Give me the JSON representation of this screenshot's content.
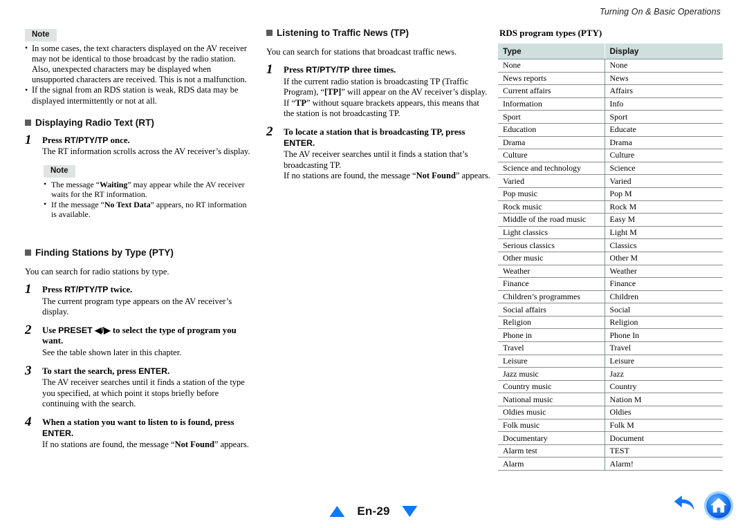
{
  "header": {
    "running_title": "Turning On & Basic Operations"
  },
  "column1": {
    "note_top": {
      "badge": "Note",
      "items": [
        "In some cases, the text characters displayed on the AV receiver may not be identical to those broadcast by the radio station. Also, unexpected characters may be displayed when unsupported characters are received. This is not a malfunction.",
        "If the signal from an RDS station is weak, RDS data may be displayed intermittently or not at all."
      ]
    },
    "section_rt": {
      "heading": "Displaying Radio Text (RT)",
      "steps": [
        {
          "num": "1",
          "title_pre": "Press ",
          "title_key": "RT/PTY/TP",
          "title_post": " once.",
          "body": "The RT information scrolls across the AV receiver’s display."
        }
      ],
      "inner_note": {
        "badge": "Note",
        "items": [
          "The message “Waiting” may appear while the AV receiver waits for the RT information.",
          "If the message “No Text Data” appears, no RT information is available."
        ]
      }
    },
    "section_pty": {
      "heading": "Finding Stations by Type (PTY)",
      "intro": "You can search for radio stations by type.",
      "steps": [
        {
          "num": "1",
          "title_pre": "Press ",
          "title_key": "RT/PTY/TP",
          "title_post": " twice.",
          "body": "The current program type appears on the AV receiver’s display."
        },
        {
          "num": "2",
          "title_pre": "Use ",
          "title_key": "PRESET ◀/▶",
          "title_post": " to select the type of program you want.",
          "body": "See the table shown later in this chapter."
        },
        {
          "num": "3",
          "title_pre": "To start the search, press ",
          "title_key": "ENTER",
          "title_post": ".",
          "body": "The AV receiver searches until it finds a station of the type you specified, at which point it stops briefly before continuing with the search."
        },
        {
          "num": "4",
          "title_pre": "When a station you want to listen to is found, press ",
          "title_key": "ENTER",
          "title_post": ".",
          "body": "If no stations are found, the message “Not Found” appears."
        }
      ]
    }
  },
  "column2": {
    "section_tp": {
      "heading": "Listening to Traffic News (TP)",
      "intro": "You can search for stations that broadcast traffic news.",
      "steps": [
        {
          "num": "1",
          "title_pre": "Press ",
          "title_key": "RT/PTY/TP",
          "title_post": " three times.",
          "body": "If the current radio station is broadcasting TP (Traffic Program), “[TP]” will appear on the AV receiver’s display. If “TP” without square brackets appears, this means that the station is not broadcasting TP."
        },
        {
          "num": "2",
          "title_pre": "To locate a station that is broadcasting TP, press ",
          "title_key": "ENTER",
          "title_post": ".",
          "body": "The AV receiver searches until it finds a station that’s broadcasting TP.",
          "body2": "If no stations are found, the message “Not Found” appears."
        }
      ]
    }
  },
  "column3": {
    "table_title": "RDS program types (PTY)",
    "columns": [
      "Type",
      "Display"
    ],
    "rows": [
      [
        "None",
        "None"
      ],
      [
        "News reports",
        "News"
      ],
      [
        "Current affairs",
        "Affairs"
      ],
      [
        "Information",
        "Info"
      ],
      [
        "Sport",
        "Sport"
      ],
      [
        "Education",
        "Educate"
      ],
      [
        "Drama",
        "Drama"
      ],
      [
        "Culture",
        "Culture"
      ],
      [
        "Science and technology",
        "Science"
      ],
      [
        "Varied",
        "Varied"
      ],
      [
        "Pop music",
        "Pop M"
      ],
      [
        "Rock music",
        "Rock M"
      ],
      [
        "Middle of the road music",
        "Easy M"
      ],
      [
        "Light classics",
        "Light M"
      ],
      [
        "Serious classics",
        "Classics"
      ],
      [
        "Other music",
        "Other M"
      ],
      [
        "Weather",
        "Weather"
      ],
      [
        "Finance",
        "Finance"
      ],
      [
        "Children’s programmes",
        "Children"
      ],
      [
        "Social affairs",
        "Social"
      ],
      [
        "Religion",
        "Religion"
      ],
      [
        "Phone in",
        "Phone In"
      ],
      [
        "Travel",
        "Travel"
      ],
      [
        "Leisure",
        "Leisure"
      ],
      [
        "Jazz music",
        "Jazz"
      ],
      [
        "Country music",
        "Country"
      ],
      [
        "National music",
        "Nation M"
      ],
      [
        "Oldies music",
        "Oldies"
      ],
      [
        "Folk music",
        "Folk M"
      ],
      [
        "Documentary",
        "Document"
      ],
      [
        "Alarm test",
        "TEST"
      ],
      [
        "Alarm",
        "Alarm!"
      ]
    ]
  },
  "footer": {
    "page_label": "En-29",
    "prev_icon": "triangle-up-icon",
    "next_icon": "triangle-down-icon",
    "back_icon": "back-arrow-icon",
    "home_icon": "home-icon",
    "accent_color": "#1277f5",
    "table_header_color": "#cfdfdb",
    "note_badge_color": "#dfe3e1"
  }
}
